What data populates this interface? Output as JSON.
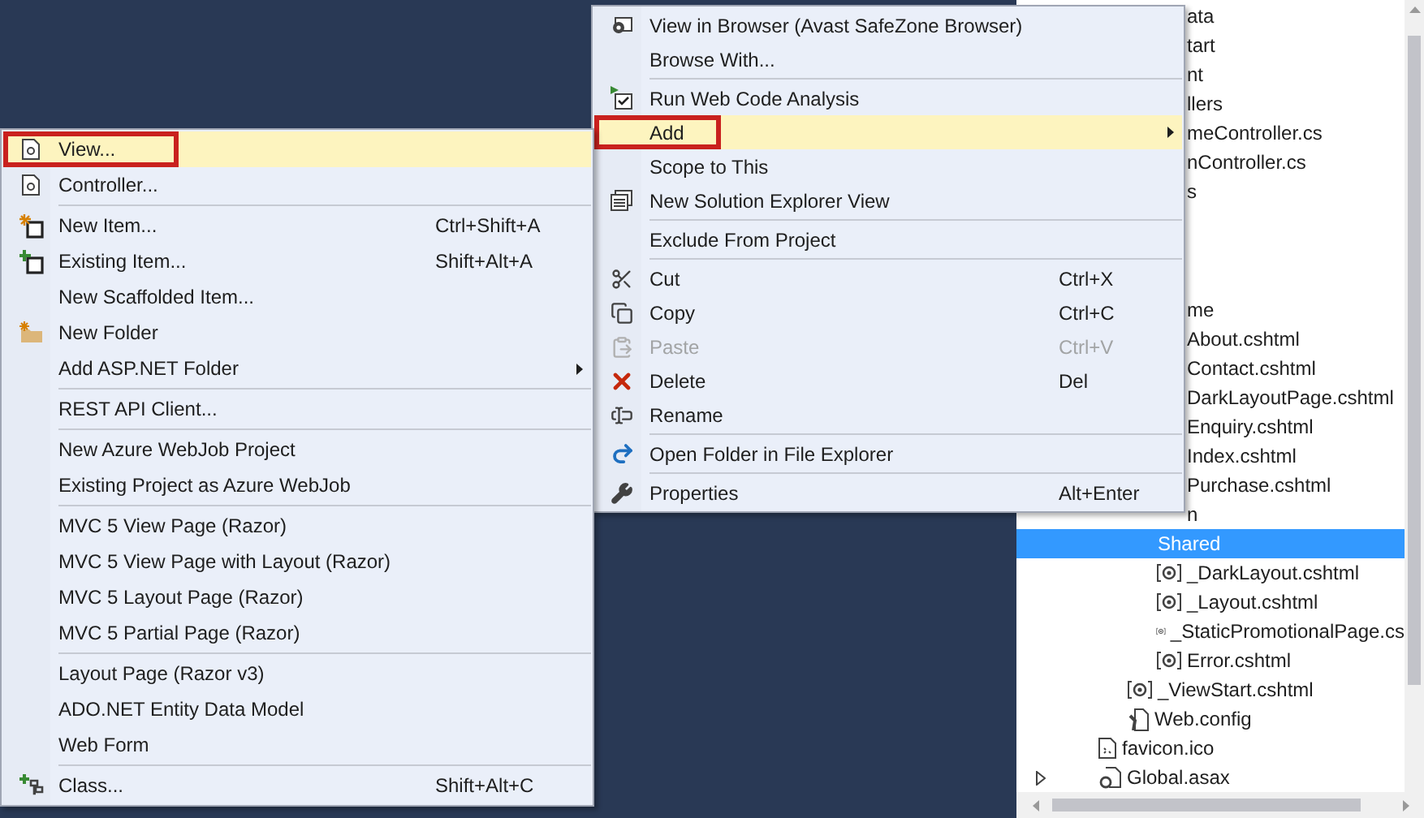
{
  "explorer": {
    "upper": [
      {
        "text": "ata"
      },
      {
        "text": "tart"
      },
      {
        "text": "nt"
      },
      {
        "text": "llers"
      },
      {
        "text": "meController.cs"
      },
      {
        "text": "nController.cs"
      },
      {
        "text": "s"
      }
    ],
    "lower": [
      {
        "text": "me",
        "cut": true,
        "children": [
          {
            "text": "About.cshtml"
          },
          {
            "text": "Contact.cshtml"
          },
          {
            "text": "DarkLayoutPage.cshtml"
          },
          {
            "text": "Enquiry.cshtml"
          },
          {
            "text": "Index.cshtml"
          },
          {
            "text": "Purchase.cshtml"
          }
        ]
      },
      {
        "text": "n",
        "cut": true
      },
      {
        "text": "Shared",
        "cut": false,
        "kind": "folder",
        "selected": true,
        "children": [
          {
            "text": "_DarkLayout.cshtml",
            "kind": "razor"
          },
          {
            "text": "_Layout.cshtml",
            "kind": "razor"
          },
          {
            "text": "_StaticPromotionalPage.cs",
            "kind": "razor"
          },
          {
            "text": "Error.cshtml",
            "kind": "razor"
          }
        ]
      },
      {
        "text": "_ViewStart.cshtml",
        "kind": "razor"
      },
      {
        "text": "Web.config",
        "kind": "config"
      }
    ],
    "root": [
      {
        "text": "favicon.ico",
        "kind": "image"
      },
      {
        "text": "Global.asax",
        "kind": "code",
        "expanded": false
      }
    ]
  },
  "right_menu": {
    "items": [
      {
        "kind": "browser",
        "label": "View in Browser (Avast SafeZone Browser)",
        "selected": false,
        "marked": false,
        "submenu": false,
        "disabled": false
      },
      {
        "kind": "item",
        "label": "Browse With...",
        "selected": false,
        "marked": false,
        "submenu": false,
        "disabled": false
      },
      {
        "kind": "separator"
      },
      {
        "kind": "analysis",
        "label": "Run Web Code Analysis",
        "selected": false,
        "marked": false,
        "submenu": false,
        "disabled": false
      },
      {
        "kind": "item",
        "label": "Add",
        "selected": true,
        "marked": true,
        "submenu": true,
        "disabled": false
      },
      {
        "kind": "item",
        "label": "Scope to This",
        "selected": false,
        "marked": false,
        "submenu": false,
        "disabled": false
      },
      {
        "kind": "solution-view",
        "label": "New Solution Explorer View",
        "selected": false,
        "marked": false,
        "submenu": false,
        "disabled": false
      },
      {
        "kind": "separator"
      },
      {
        "kind": "item",
        "label": "Exclude From Project",
        "selected": false,
        "marked": false,
        "submenu": false,
        "disabled": false
      },
      {
        "kind": "separator"
      },
      {
        "kind": "cut",
        "label": "Cut",
        "shortcut": "Ctrl+X",
        "selected": false,
        "marked": false,
        "submenu": false,
        "disabled": false
      },
      {
        "kind": "copy",
        "label": "Copy",
        "shortcut": "Ctrl+C",
        "selected": false,
        "marked": false,
        "submenu": false,
        "disabled": false
      },
      {
        "kind": "paste",
        "label": "Paste",
        "shortcut": "Ctrl+V",
        "selected": false,
        "marked": false,
        "submenu": false,
        "disabled": true
      },
      {
        "kind": "delete",
        "label": "Delete",
        "shortcut": "Del",
        "selected": false,
        "marked": false,
        "submenu": false,
        "disabled": false
      },
      {
        "kind": "rename",
        "label": "Rename",
        "selected": false,
        "marked": false,
        "submenu": false,
        "disabled": false
      },
      {
        "kind": "separator"
      },
      {
        "kind": "open-folder",
        "label": "Open Folder in File Explorer",
        "selected": false,
        "marked": false,
        "submenu": false,
        "disabled": false
      },
      {
        "kind": "separator"
      },
      {
        "kind": "properties",
        "label": "Properties",
        "shortcut": "Alt+Enter",
        "selected": false,
        "marked": false,
        "submenu": false,
        "disabled": false
      }
    ]
  },
  "left_menu": {
    "items": [
      {
        "kind": "view",
        "label": "View...",
        "selected": true,
        "marked": true,
        "submenu": false
      },
      {
        "kind": "view",
        "label": "Controller...",
        "selected": false,
        "marked": false,
        "submenu": false
      },
      {
        "kind": "separator"
      },
      {
        "kind": "new-item",
        "label": "New Item...",
        "shortcut": "Ctrl+Shift+A",
        "selected": false,
        "marked": false,
        "submenu": false
      },
      {
        "kind": "existing-item",
        "label": "Existing Item...",
        "shortcut": "Shift+Alt+A",
        "selected": false,
        "marked": false,
        "submenu": false
      },
      {
        "kind": "item",
        "label": "New Scaffolded Item...",
        "selected": false,
        "marked": false,
        "submenu": false
      },
      {
        "kind": "new-folder",
        "label": "New Folder",
        "selected": false,
        "marked": false,
        "submenu": false
      },
      {
        "kind": "item",
        "label": "Add ASP.NET Folder",
        "selected": false,
        "marked": false,
        "submenu": true
      },
      {
        "kind": "separator"
      },
      {
        "kind": "item",
        "label": "REST API Client...",
        "selected": false,
        "marked": false,
        "submenu": false
      },
      {
        "kind": "separator"
      },
      {
        "kind": "item",
        "label": "New Azure WebJob Project",
        "selected": false,
        "marked": false,
        "submenu": false
      },
      {
        "kind": "item",
        "label": "Existing Project as Azure WebJob",
        "selected": false,
        "marked": false,
        "submenu": false
      },
      {
        "kind": "separator"
      },
      {
        "kind": "item",
        "label": "MVC 5 View Page (Razor)",
        "selected": false,
        "marked": false,
        "submenu": false
      },
      {
        "kind": "item",
        "label": "MVC 5 View Page with Layout (Razor)",
        "selected": false,
        "marked": false,
        "submenu": false
      },
      {
        "kind": "item",
        "label": "MVC 5 Layout Page (Razor)",
        "selected": false,
        "marked": false,
        "submenu": false
      },
      {
        "kind": "item",
        "label": "MVC 5 Partial Page (Razor)",
        "selected": false,
        "marked": false,
        "submenu": false
      },
      {
        "kind": "separator"
      },
      {
        "kind": "item",
        "label": "Layout Page (Razor v3)",
        "selected": false,
        "marked": false,
        "submenu": false
      },
      {
        "kind": "item",
        "label": "ADO.NET Entity Data Model",
        "selected": false,
        "marked": false,
        "submenu": false
      },
      {
        "kind": "item",
        "label": "Web Form",
        "selected": false,
        "marked": false,
        "submenu": false
      },
      {
        "kind": "separator"
      },
      {
        "kind": "class",
        "label": "Class...",
        "shortcut": "Shift+Alt+C",
        "selected": false,
        "marked": false,
        "submenu": false
      }
    ]
  }
}
